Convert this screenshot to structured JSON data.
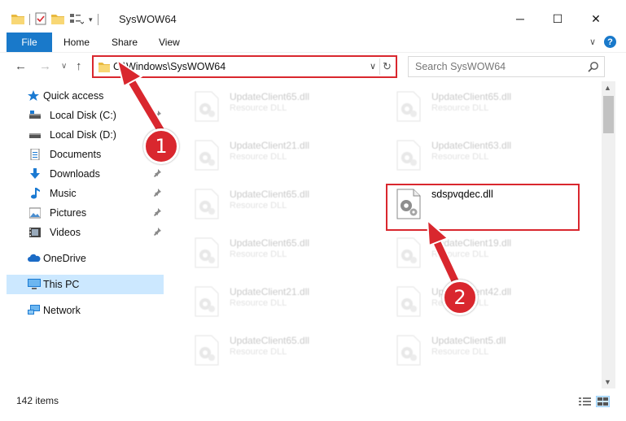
{
  "window": {
    "title": "SysWOW64",
    "controls": {
      "minimize": "─",
      "maximize": "☐",
      "close": "✕"
    }
  },
  "ribbon": {
    "tabs": [
      "File",
      "Home",
      "Share",
      "View"
    ],
    "help": "?",
    "expand": "∨"
  },
  "nav": {
    "back": "←",
    "forward": "→",
    "recent": "∨",
    "up": "↑",
    "address": "C:\\Windows\\SysWOW64",
    "address_dropdown": "∨",
    "refresh": "↻",
    "search_placeholder": "Search SysWOW64"
  },
  "sidebar": {
    "items": [
      {
        "label": "Quick access",
        "icon": "star-icon",
        "pinned": false
      },
      {
        "label": "Local Disk (C:)",
        "icon": "drive-icon",
        "pinned": true
      },
      {
        "label": "Local Disk (D:)",
        "icon": "drive-icon",
        "pinned": false
      },
      {
        "label": "Documents",
        "icon": "documents-icon",
        "pinned": true
      },
      {
        "label": "Downloads",
        "icon": "download-icon",
        "pinned": true
      },
      {
        "label": "Music",
        "icon": "music-icon",
        "pinned": true
      },
      {
        "label": "Pictures",
        "icon": "pictures-icon",
        "pinned": true
      },
      {
        "label": "Videos",
        "icon": "videos-icon",
        "pinned": true
      },
      {
        "label": "OneDrive",
        "icon": "cloud-icon",
        "pinned": false
      },
      {
        "label": "This PC",
        "icon": "computer-icon",
        "pinned": false,
        "selected": true
      },
      {
        "label": "Network",
        "icon": "network-icon",
        "pinned": false
      }
    ],
    "pin_glyph": "📌"
  },
  "files": {
    "left": [
      {
        "name": "UpdateClient65.dll",
        "type": "Resource DLL"
      },
      {
        "name": "UpdateClient21.dll",
        "type": "Resource DLL"
      },
      {
        "name": "UpdateClient65.dll",
        "type": "Resource DLL"
      },
      {
        "name": "UpdateClient65.dll",
        "type": "Resource DLL"
      },
      {
        "name": "UpdateClient21.dll",
        "type": "Resource DLL"
      },
      {
        "name": "UpdateClient65.dll",
        "type": "Resource DLL"
      }
    ],
    "right": [
      {
        "name": "UpdateClient65.dll",
        "type": "Resource DLL"
      },
      {
        "name": "UpdateClient63.dll",
        "type": "Resource DLL"
      },
      {
        "name": "sdspvqdec.dll",
        "type": ""
      },
      {
        "name": "UpdateClient19.dll",
        "type": "Resource DLL"
      },
      {
        "name": "UpdateClient42.dll",
        "type": "Resource DLL"
      },
      {
        "name": "UpdateClient5.dll",
        "type": "Resource DLL"
      }
    ]
  },
  "status": {
    "item_count": "142 items"
  },
  "annotations": {
    "step1": "1",
    "step2": "2"
  },
  "colors": {
    "accent": "#1979ca",
    "annotation": "#d9272e",
    "selected": "#cce8ff"
  }
}
